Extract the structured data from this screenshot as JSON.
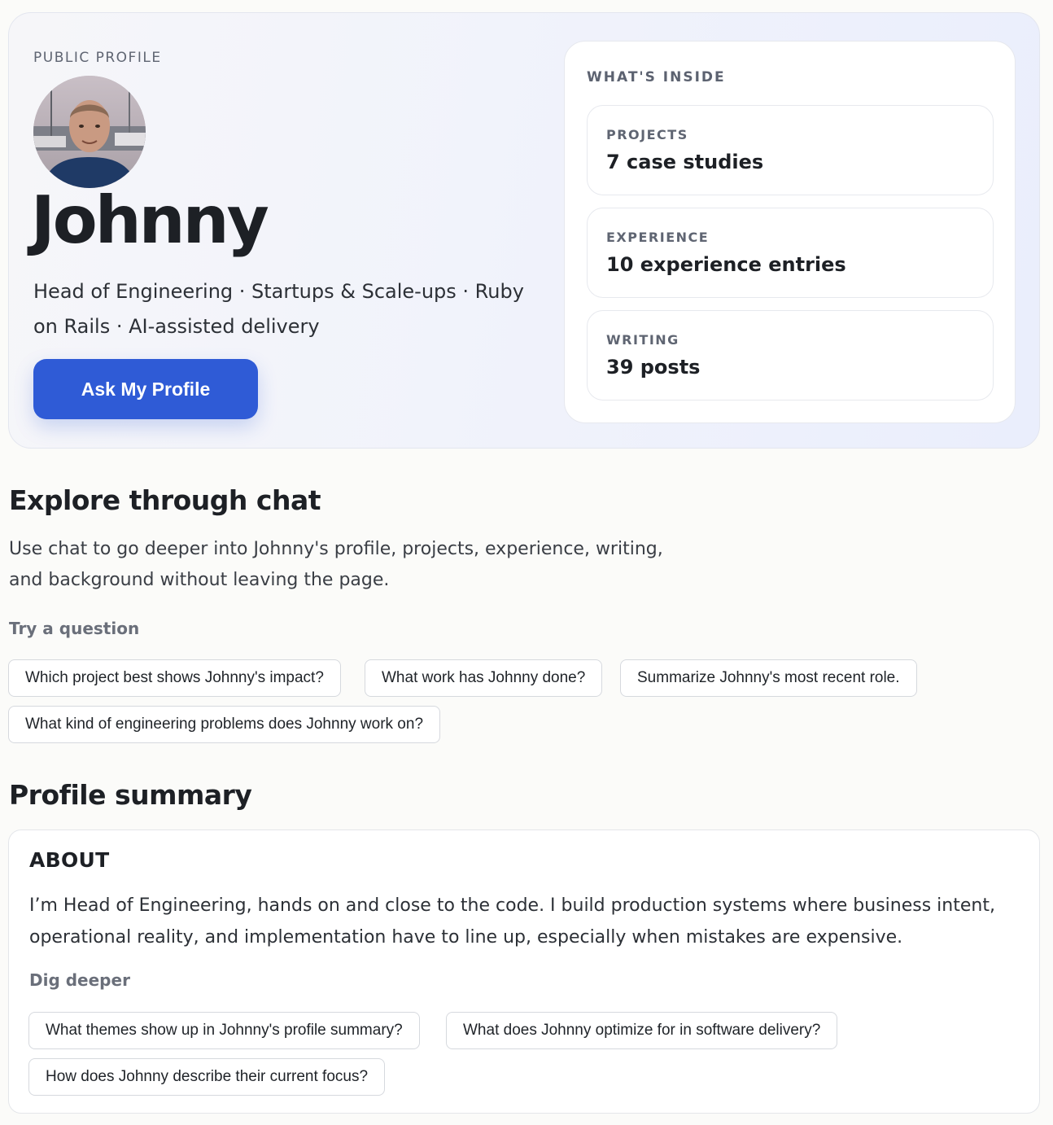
{
  "hero": {
    "eyebrow": "PUBLIC PROFILE",
    "name": "Johnny",
    "tagline": "Head of Engineering · Startups & Scale-ups · Ruby on Rails · AI-assisted delivery",
    "cta_label": "Ask My Profile"
  },
  "inside": {
    "title": "WHAT'S INSIDE",
    "cards": [
      {
        "label": "PROJECTS",
        "value": "7 case studies"
      },
      {
        "label": "EXPERIENCE",
        "value": "10 experience entries"
      },
      {
        "label": "WRITING",
        "value": "39 posts"
      }
    ]
  },
  "explore": {
    "heading": "Explore through chat",
    "body": "Use chat to go deeper into Johnny's profile, projects, experience, writing, and background without leaving the page.",
    "prompt_label": "Try a question",
    "questions": [
      "Which project best shows Johnny's impact?",
      "What work has Johnny done?",
      "Summarize Johnny's most recent role.",
      "What kind of engineering problems does Johnny work on?"
    ]
  },
  "summary": {
    "heading": "Profile summary",
    "about_title": "ABOUT",
    "about_body": "I’m Head of Engineering, hands on and close to the code. I build production systems where business intent, operational reality, and implementation have to line up, especially when mistakes are expensive.",
    "dig_label": "Dig deeper",
    "questions": [
      "What themes show up in Johnny's profile summary?",
      "What does Johnny optimize for in software delivery?",
      "How does Johnny describe their current focus?"
    ]
  },
  "colors": {
    "accent": "#2f5bd6",
    "text": "#1d2025",
    "muted": "#5f6572",
    "background": "#fbfbf9"
  }
}
